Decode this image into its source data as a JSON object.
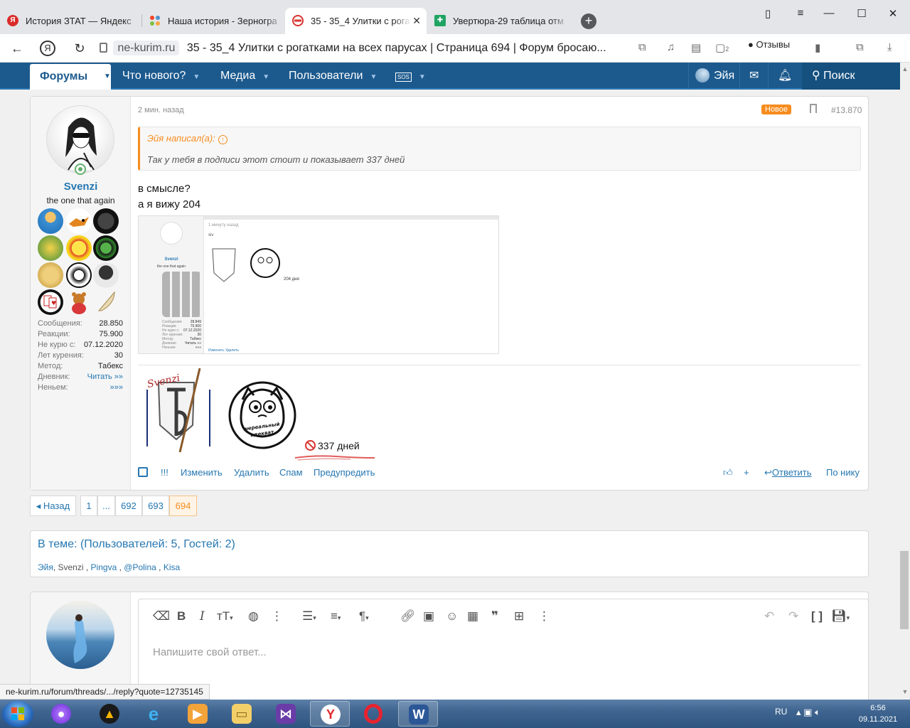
{
  "browser": {
    "tabs": [
      {
        "label": "История ЗТАТ — Яндекс",
        "icon": "yandex-icon",
        "color": "#d92b2b"
      },
      {
        "label": "Наша история - Зерногра",
        "icon": "joomla-icon",
        "color": "#f44321"
      },
      {
        "label": "35 - 35_4 Улитки с рога",
        "icon": "no-smoking-icon",
        "color": "#d9322e",
        "active": true
      },
      {
        "label": "Увертюра-29 таблица отм",
        "icon": "sheets-icon",
        "color": "#1fa463"
      }
    ],
    "new_tab": "+",
    "url_domain": "ne-kurim.ru",
    "page_title": "35 - 35_4 Улитки с рогатками на всех парусах | Страница 694 | Форум бросаю...",
    "review_label": "Отзывы",
    "tab_count_badge": "2"
  },
  "forum_nav": {
    "forums": "Форумы",
    "whats_new": "Что нового?",
    "media": "Медиа",
    "users": "Пользователи",
    "sos": "SOS",
    "account": "Эйя",
    "search": "Поиск"
  },
  "post": {
    "author": "Svenzi",
    "author_title": "the one that again",
    "time": "2 мин. назад",
    "new_badge": "Новое",
    "post_number": "#13.870",
    "quote_author": "Эйя написал(а):",
    "quote_text": "Так у тебя в подписи этот стоит и показывает 337 дней",
    "body_lines": [
      "в смысле?",
      "а я вижу 204"
    ],
    "stats": [
      {
        "label": "Сообщения:",
        "value": "28.850"
      },
      {
        "label": "Реакции:",
        "value": "75.900"
      },
      {
        "label": "Не курю с:",
        "value": "07.12.2020"
      },
      {
        "label": "Лет курения:",
        "value": "30"
      },
      {
        "label": "Метод:",
        "value": "Табекс"
      },
      {
        "label": "Дневник:",
        "value": "Читать »»",
        "link": true
      },
      {
        "label": "Неньем:",
        "value": "»»»",
        "link": true
      }
    ],
    "signature_days": "337 дней",
    "signature_shield_text": "Svenzi",
    "signature_cat_text": "нереальный адекват",
    "actions": {
      "exclaim": "!!!",
      "edit": "Изменить",
      "delete": "Удалить",
      "spam": "Спам",
      "warn": "Предупредить",
      "reply": "Ответить",
      "by_reply": "По нику"
    },
    "embedded_screenshot": {
      "time": "1 минуту назад",
      "text": "xiv",
      "days": "204 дня",
      "name": "Svenzi",
      "title": "the one that again",
      "stats": [
        {
          "label": "Сообщения:",
          "value": "28.849"
        },
        {
          "label": "Реакции:",
          "value": "75.900"
        },
        {
          "label": "Не курю с:",
          "value": "07.12.2020"
        },
        {
          "label": "Лет курения:",
          "value": "30"
        },
        {
          "label": "Метод:",
          "value": "Табекс"
        },
        {
          "label": "Дневник:",
          "value": "Читать »»"
        },
        {
          "label": "Неньем:",
          "value": "»»»"
        }
      ],
      "actions": "Изменить   Удалить"
    }
  },
  "pager": {
    "prev": "◂ Назад",
    "pages": [
      "1",
      "...",
      "692",
      "693",
      "694"
    ],
    "current": "694"
  },
  "in_thread": {
    "title": "В теме: (Пользователей: 5, Гостей: 2)",
    "users": [
      "Эйя",
      "Svenzi",
      "Pingva",
      "@Polina",
      "Kisa"
    ]
  },
  "reply_editor": {
    "placeholder": "Напишите свой ответ..."
  },
  "status_url": "ne-kurim.ru/forum/threads/.../reply?quote=12735145",
  "taskbar": {
    "lang": "RU",
    "time": "6:56",
    "date": "09.11.2021"
  },
  "colors": {
    "nav_bg": "#1c5a8e",
    "link": "#2577b1",
    "accent_orange": "#f78c1e"
  }
}
